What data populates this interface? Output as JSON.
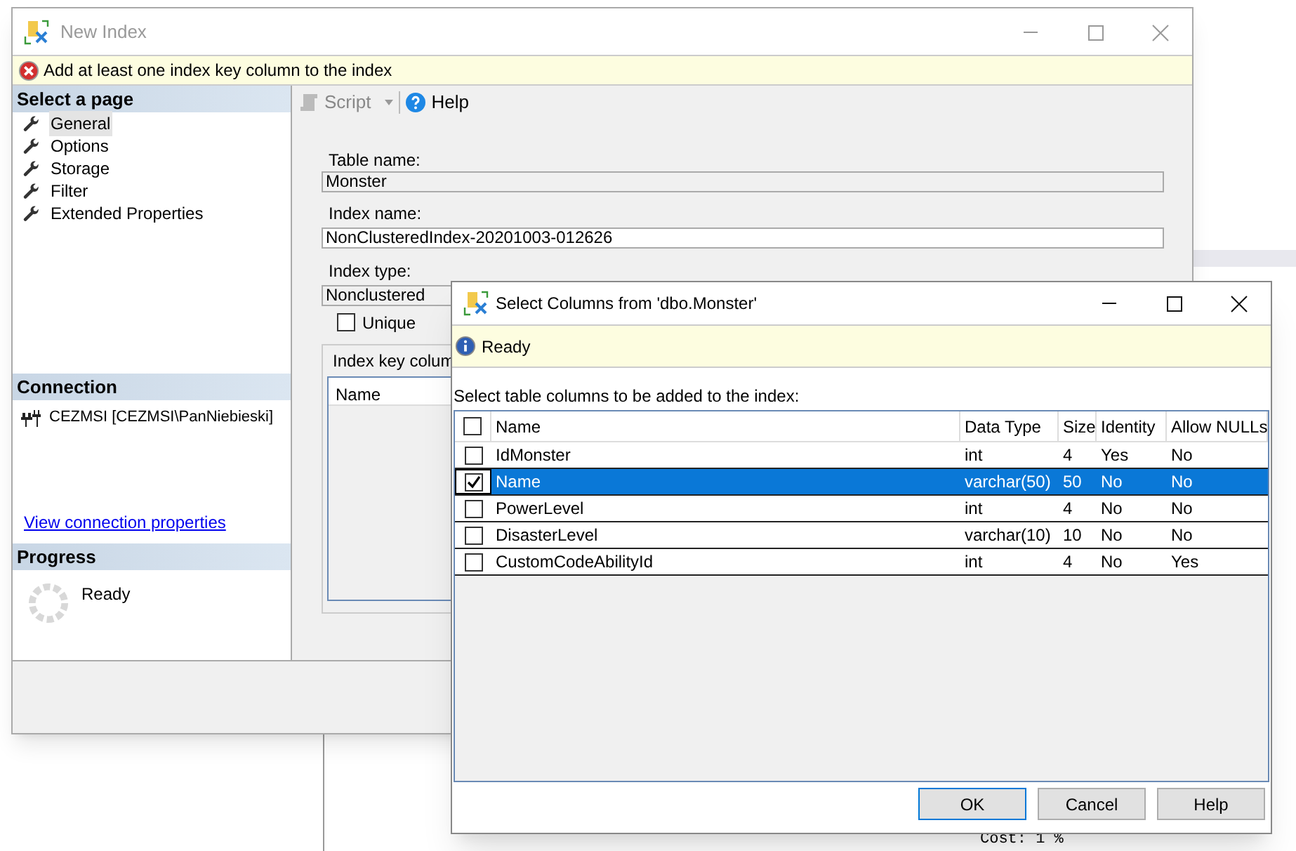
{
  "background_editor": {
    "cost": "Cost: 1 %"
  },
  "main_window": {
    "title": "New Index",
    "error": "Add at least one index key column to the index",
    "pages_header": "Select a page",
    "pages": [
      {
        "label": "General",
        "selected": true
      },
      {
        "label": "Options",
        "selected": false
      },
      {
        "label": "Storage",
        "selected": false
      },
      {
        "label": "Filter",
        "selected": false
      },
      {
        "label": "Extended Properties",
        "selected": false
      }
    ],
    "connection_header": "Connection",
    "connection": "CEZMSI [CEZMSI\\PanNiebieski]",
    "connection_link": "View connection properties",
    "progress_header": "Progress",
    "progress_status": "Ready",
    "toolbar": {
      "script": "Script",
      "help": "Help"
    },
    "table_name_label": "Table name:",
    "table_name": "Monster",
    "index_name_label": "Index name:",
    "index_name": "NonClusteredIndex-20201003-012626",
    "index_type_label": "Index type:",
    "index_type": "Nonclustered",
    "unique": {
      "label": "Unique",
      "checked": false
    },
    "key_columns": {
      "title": "Index key colum",
      "columns": [
        "Name"
      ]
    }
  },
  "dialog": {
    "title": "Select Columns from 'dbo.Monster'",
    "status": "Ready",
    "prompt": "Select table columns to be added to the index:",
    "all_checked": false,
    "columns": [
      "Name",
      "Data Type",
      "Size",
      "Identity",
      "Allow NULLs"
    ],
    "rows": [
      {
        "name": "IdMonster",
        "data_type": "int",
        "size": "4",
        "identity": "Yes",
        "allow_nulls": "No",
        "checked": false,
        "selected": false
      },
      {
        "name": "Name",
        "data_type": "varchar(50)",
        "size": "50",
        "identity": "No",
        "allow_nulls": "No",
        "checked": true,
        "selected": true
      },
      {
        "name": "PowerLevel",
        "data_type": "int",
        "size": "4",
        "identity": "No",
        "allow_nulls": "No",
        "checked": false,
        "selected": false
      },
      {
        "name": "DisasterLevel",
        "data_type": "varchar(10)",
        "size": "10",
        "identity": "No",
        "allow_nulls": "No",
        "checked": false,
        "selected": false
      },
      {
        "name": "CustomCodeAbilityId",
        "data_type": "int",
        "size": "4",
        "identity": "No",
        "allow_nulls": "Yes",
        "checked": false,
        "selected": false
      }
    ],
    "buttons": [
      {
        "label": "OK",
        "default": true
      },
      {
        "label": "Cancel",
        "default": false
      },
      {
        "label": "Help",
        "default": false
      }
    ]
  }
}
